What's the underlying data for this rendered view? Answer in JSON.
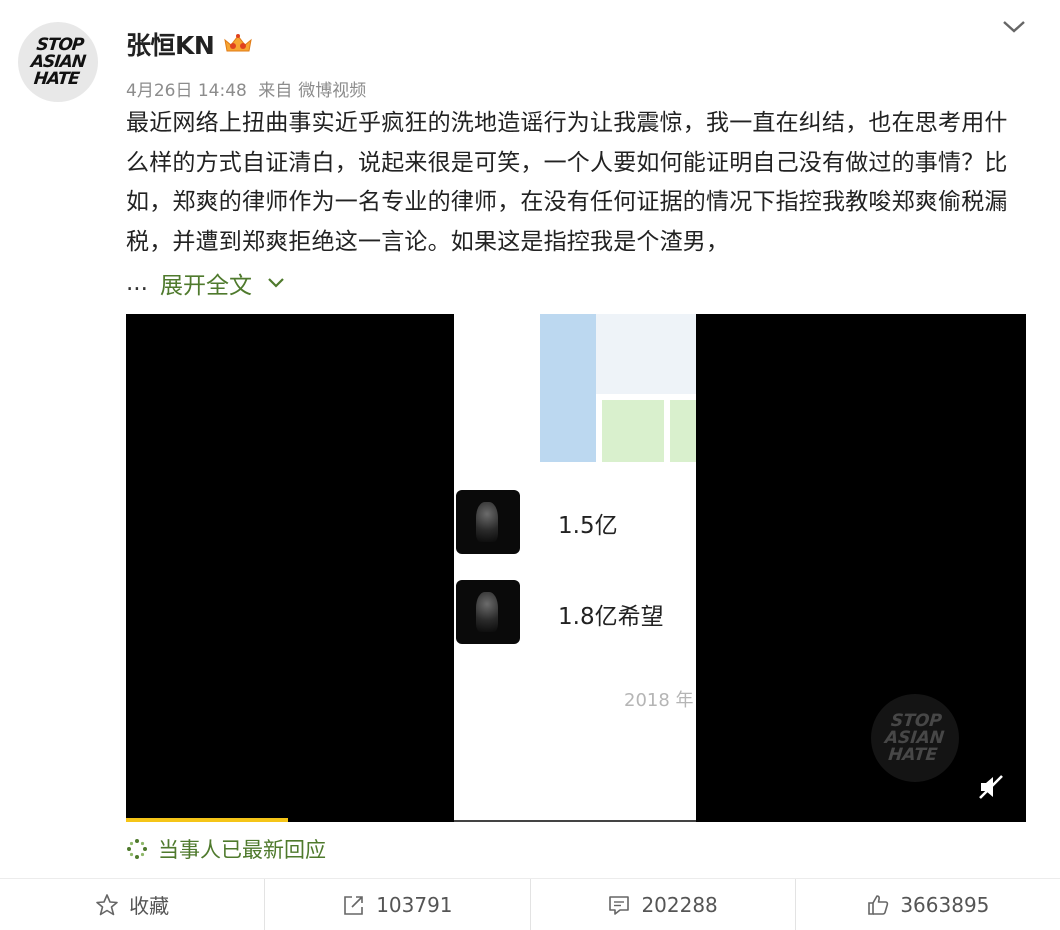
{
  "user": {
    "name": "张恒KN",
    "avatar_text": "STOP\nASIAN\nHATE"
  },
  "post": {
    "date": "4月26日 14:48",
    "from_label": "来自",
    "source": "微博视频",
    "text": "最近网络上扭曲事实近乎疯狂的洗地造谣行为让我震惊，我一直在纠结，也在思考用什么样的方式自证清白，说起来很是可笑，一个人要如何能证明自己没有做过的事情？比如，郑爽的律师作为一名专业的律师，在没有任何证据的情况下指控我教唆郑爽偷税漏税，并遭到郑爽拒绝这一言论。如果这是指控我是个渣男，",
    "ellipsis": "...",
    "expand_label": "展开全文"
  },
  "video": {
    "stat1": "1.5亿",
    "stat2": "1.8亿希望",
    "year_text": "2018 年",
    "watermark_text": "STOP\nASIAN\nHATE",
    "progress": 0.18
  },
  "update_tag": "当事人已最新回应",
  "actions": {
    "favorite": "收藏",
    "repost": "103791",
    "comment": "202288",
    "like": "3663895"
  },
  "colors": {
    "link_green": "#4f7a2d",
    "progress_yellow": "#f5c518"
  }
}
